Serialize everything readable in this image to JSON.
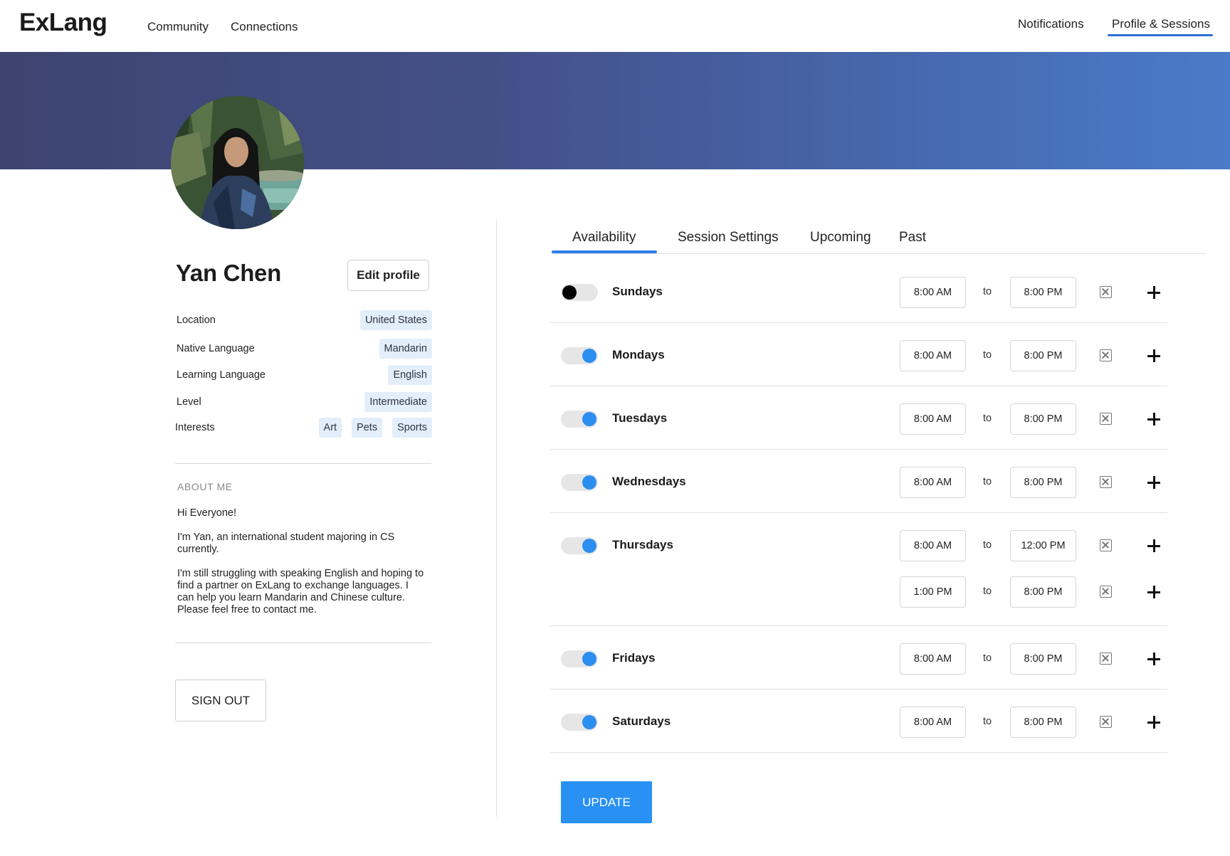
{
  "nav": {
    "logo": "ExLang",
    "links": [
      "Community",
      "Connections"
    ],
    "right_links": [
      "Notifications",
      "Profile & Sessions"
    ],
    "active": "Profile & Sessions",
    "accent": "#2f6fd8"
  },
  "banner": {
    "gradient_start": "#3d446f",
    "gradient_end": "#4a7bc8"
  },
  "profile": {
    "name": "Yan Chen",
    "edit_label": "Edit  profile",
    "details": [
      {
        "label": "Location",
        "tags": [
          "United States"
        ]
      },
      {
        "label": "Native Language",
        "tags": [
          "Mandarin"
        ]
      },
      {
        "label": "Learning Language",
        "tags": [
          "English"
        ]
      },
      {
        "label": "Level",
        "tags": [
          "Intermediate"
        ]
      },
      {
        "label": "Interests",
        "tags": [
          "Art",
          "Pets",
          "Sports"
        ]
      }
    ],
    "about_heading": "ABOUT  ME",
    "about": [
      "Hi Everyone!",
      "I'm Yan, an international student majoring in CS currently.",
      "I'm still struggling with speaking English and hoping to find a partner on ExLang to exchange languages. I can help you learn Mandarin and Chinese culture. Please feel free to contact me."
    ],
    "sign_out_label": "SIGN OUT"
  },
  "tabs": {
    "items": [
      "Availability",
      "Session Settings",
      "Upcoming",
      "Past"
    ],
    "active": "Availability"
  },
  "availability": {
    "to_label": "to",
    "days": [
      {
        "name": "Sundays",
        "enabled": false,
        "slots": [
          {
            "from": "8:00 AM",
            "to": "8:00 PM"
          }
        ]
      },
      {
        "name": "Mondays",
        "enabled": true,
        "slots": [
          {
            "from": "8:00 AM",
            "to": "8:00 PM"
          }
        ]
      },
      {
        "name": "Tuesdays",
        "enabled": true,
        "slots": [
          {
            "from": "8:00 AM",
            "to": "8:00 PM"
          }
        ]
      },
      {
        "name": "Wednesdays",
        "enabled": true,
        "slots": [
          {
            "from": "8:00 AM",
            "to": "8:00 PM"
          }
        ]
      },
      {
        "name": "Thursdays",
        "enabled": true,
        "slots": [
          {
            "from": "8:00 AM",
            "to": "12:00 PM"
          },
          {
            "from": "1:00 PM",
            "to": "8:00 PM"
          }
        ]
      },
      {
        "name": "Fridays",
        "enabled": true,
        "slots": [
          {
            "from": "8:00 AM",
            "to": "8:00 PM"
          }
        ]
      },
      {
        "name": "Saturdays",
        "enabled": true,
        "slots": [
          {
            "from": "8:00 AM",
            "to": "8:00 PM"
          }
        ]
      }
    ],
    "toggle_on_color": "#2b8ef0",
    "update_label": "UPDATE",
    "update_color": "#2891f3"
  }
}
